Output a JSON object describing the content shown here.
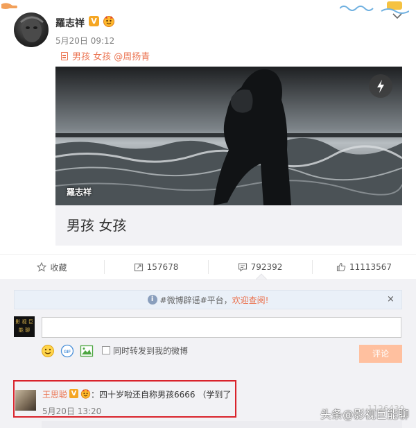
{
  "post": {
    "author": "羅志祥",
    "verified_badge": "V",
    "time": "5月20日 09:12",
    "text": "男孩 女孩 @周扬青",
    "card": {
      "image_caption": "羅志祥",
      "title": "男孩 女孩"
    }
  },
  "actions": {
    "favorite": "收藏",
    "repost_count": "157678",
    "comment_count": "792392",
    "like_count": "11113567"
  },
  "notice": {
    "text": "#微博辟谣#平台，",
    "link": "欢迎查阅!",
    "close": "×"
  },
  "composer": {
    "my_avatar_text": "影 视 巨 能 聊",
    "input_value": "",
    "also_repost_label": "同时转发到我的微博",
    "submit_label": "评论"
  },
  "comment": {
    "name": "王思聪",
    "verified_badge": "V",
    "text": "：四十岁啦还自称男孩6666 （学到了",
    "time": "5月20日 13:20"
  },
  "watermark": {
    "text": "头条@影视巨能聊",
    "partial_number": "1126430"
  },
  "colors": {
    "accent": "#eb7350",
    "verified": "#f5a623",
    "highlight_border": "#d9232b",
    "submit_disabled": "#ffc09f",
    "panel_bg": "#f2f2f5"
  },
  "icons": [
    "chevron-down-icon",
    "doc-icon",
    "flash-icon",
    "star-icon",
    "repost-icon",
    "comment-icon",
    "like-icon",
    "info-icon",
    "emoji-icon",
    "gif-icon",
    "image-icon"
  ]
}
